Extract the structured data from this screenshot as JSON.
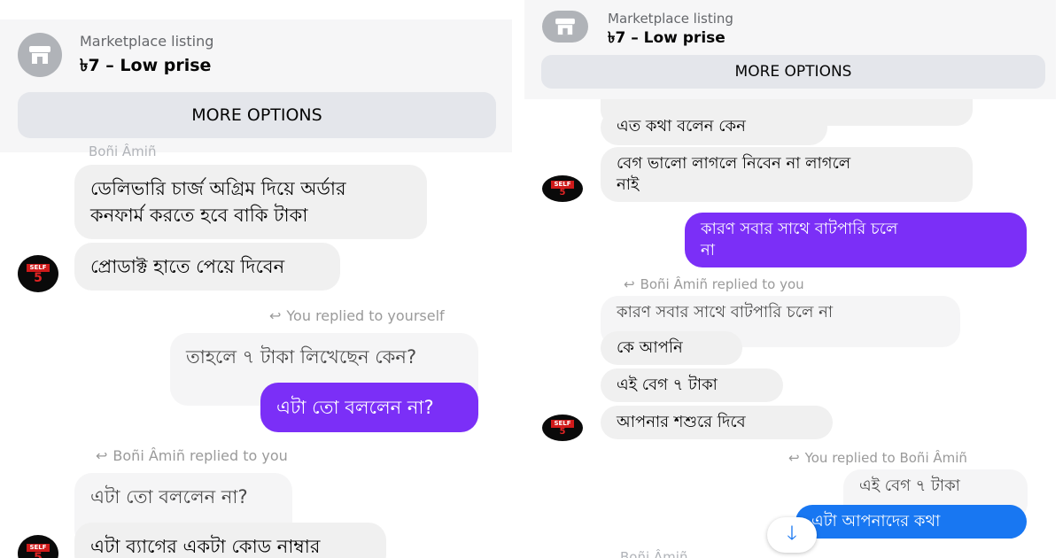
{
  "left": {
    "listing": {
      "label": "Marketplace listing",
      "price": "৳7 – Low prise",
      "more_options": "MORE OPTIONS"
    },
    "cut_sender": "Boñi Âmiñ",
    "messages": [
      "ডেলিভারি চার্জ অগ্রিম দিয়ে অর্ডার",
      "কনফার্ম করতে হবে বাকি টাকা",
      "প্রোডাক্ট হাতে পেয়ে দিবেন",
      "তাহলে ৭ টাকা লিখেছেন কেন?",
      "এটা তো বললেন না?",
      "এটা তো বললেন না?",
      "এটা ব্যাগের একটা কোড নাম্বার"
    ],
    "reply_labels": [
      "You replied to yourself",
      "Boñi Âmiñ replied to you"
    ]
  },
  "right": {
    "listing": {
      "label": "Marketplace listing",
      "price": "৳7 – Low prise",
      "more_options": "MORE OPTIONS"
    },
    "messages": [
      "এত কথা বলেন কেন",
      "বেগ ভালো লাগলে নিবেন না লাগলে",
      "নাই",
      "কারণ সবার সাথে বাটপারি চলে",
      "না",
      "কারণ সবার সাথে বাটপারি চলে না",
      "কে আপনি",
      "এই বেগ ৭ টাকা",
      "আপনার শশুরে দিবে",
      "এই বেগ ৭ টাকা",
      "এটা আপনাদের কথা"
    ],
    "reply_labels": [
      "Boñi Âmiñ replied to you",
      "You replied to Boñi Âmiñ"
    ],
    "cut_sender": "Boñi Âmiñ"
  },
  "avatar": {
    "tag": "SELF",
    "mark": "5"
  },
  "icons": {
    "listing": "store-icon",
    "reply": "reply-arrow-icon",
    "scroll": "arrow-down-icon"
  },
  "colors": {
    "outgoing": "#7b2ff7",
    "incoming": "#f0f0f0",
    "accent": "#1877f2"
  }
}
